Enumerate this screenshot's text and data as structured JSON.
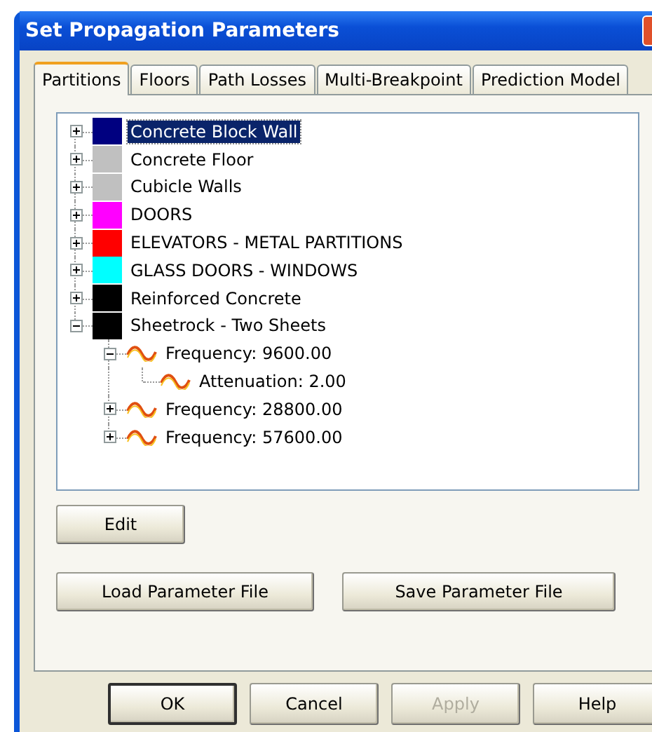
{
  "window": {
    "title": "Set Propagation Parameters"
  },
  "tabs": [
    {
      "label": "Partitions",
      "selected": true
    },
    {
      "label": "Floors",
      "selected": false
    },
    {
      "label": "Path Losses",
      "selected": false
    },
    {
      "label": "Multi-Breakpoint",
      "selected": false
    },
    {
      "label": "Prediction Model",
      "selected": false
    }
  ],
  "partitions": [
    {
      "label": "Concrete Block Wall",
      "color": "#000080",
      "expanded": false,
      "selected": true
    },
    {
      "label": "Concrete Floor",
      "color": "#c0c0c0",
      "expanded": false,
      "selected": false
    },
    {
      "label": "Cubicle Walls",
      "color": "#c0c0c0",
      "expanded": false,
      "selected": false
    },
    {
      "label": "DOORS",
      "color": "#ff00ff",
      "expanded": false,
      "selected": false
    },
    {
      "label": "ELEVATORS - METAL PARTITIONS",
      "color": "#ff0000",
      "expanded": false,
      "selected": false
    },
    {
      "label": "GLASS DOORS - WINDOWS",
      "color": "#00ffff",
      "expanded": false,
      "selected": false
    },
    {
      "label": "Reinforced Concrete",
      "color": "#000000",
      "expanded": false,
      "selected": false
    },
    {
      "label": "Sheetrock - Two Sheets",
      "color": "#000000",
      "expanded": true,
      "selected": false,
      "children": [
        {
          "kind": "frequency",
          "label": "Frequency: 9600.00",
          "expanded": true,
          "selected": false,
          "children": [
            {
              "kind": "attenuation",
              "label": "Attenuation: 2.00",
              "selected": false
            }
          ]
        },
        {
          "kind": "frequency",
          "label": "Frequency: 28800.00",
          "expanded": false,
          "selected": false
        },
        {
          "kind": "frequency",
          "label": "Frequency: 57600.00",
          "expanded": false,
          "selected": false
        }
      ]
    }
  ],
  "buttons": {
    "edit": "Edit",
    "load": "Load Parameter File",
    "save": "Save Parameter File"
  },
  "dialog_buttons": [
    {
      "label": "OK",
      "default": true,
      "disabled": false
    },
    {
      "label": "Cancel",
      "default": false,
      "disabled": false
    },
    {
      "label": "Apply",
      "default": false,
      "disabled": true
    },
    {
      "label": "Help",
      "default": false,
      "disabled": false
    }
  ]
}
